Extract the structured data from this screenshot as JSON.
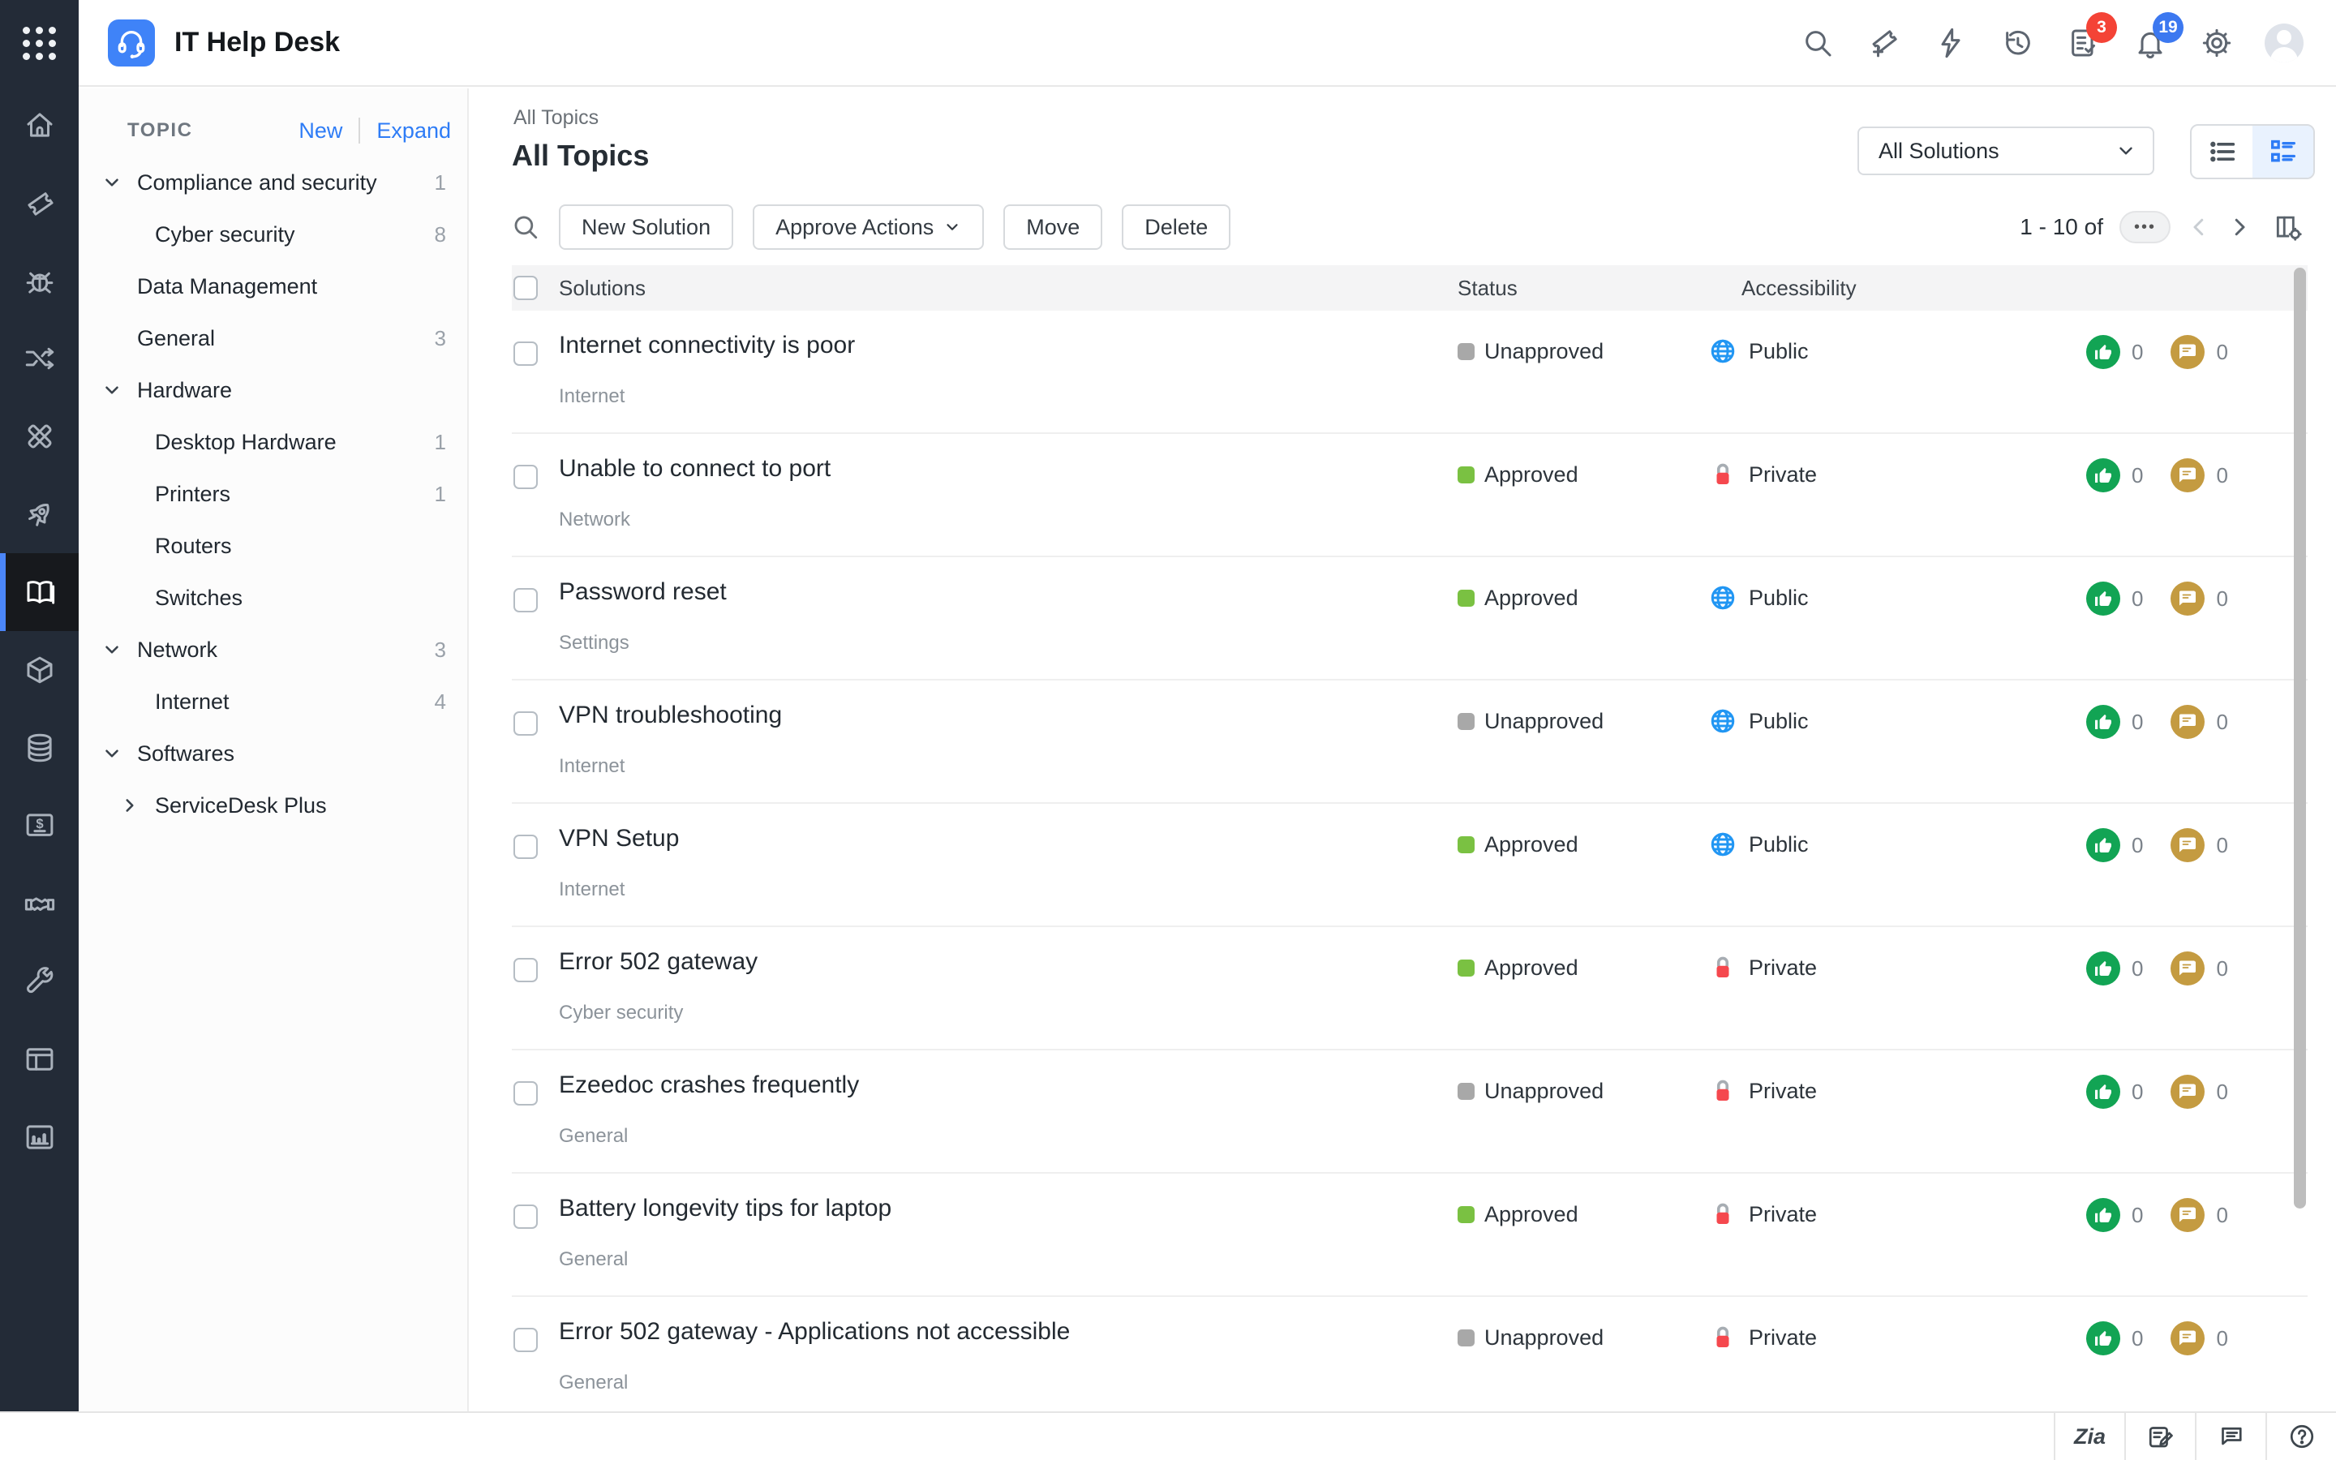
{
  "app": {
    "name": "IT Help Desk"
  },
  "topbar": {
    "icons": [
      "search-icon",
      "new-ticket-icon",
      "quick-actions-icon",
      "history-icon",
      "approvals-icon",
      "notifications-icon",
      "settings-icon",
      "avatar"
    ],
    "approvals_badge": "3",
    "notifications_badge": "19"
  },
  "rail": {
    "items": [
      "home",
      "tickets",
      "bugs",
      "changes",
      "projects",
      "releases",
      "solutions",
      "assets",
      "cmdb",
      "purchases",
      "contracts",
      "admin",
      "custom-views",
      "reports"
    ],
    "active": "solutions"
  },
  "sidebar": {
    "heading": "TOPIC",
    "new_label": "New",
    "expand_label": "Expand",
    "items": [
      {
        "label": "Compliance and security",
        "count": "1",
        "level": 0,
        "chevron": "down"
      },
      {
        "label": "Cyber security",
        "count": "8",
        "level": 1,
        "chevron": "none"
      },
      {
        "label": "Data Management",
        "count": "",
        "level": 0,
        "chevron": "none"
      },
      {
        "label": "General",
        "count": "3",
        "level": 0,
        "chevron": "none"
      },
      {
        "label": "Hardware",
        "count": "",
        "level": 0,
        "chevron": "down"
      },
      {
        "label": "Desktop Hardware",
        "count": "1",
        "level": 1,
        "chevron": "none"
      },
      {
        "label": "Printers",
        "count": "1",
        "level": 1,
        "chevron": "none"
      },
      {
        "label": "Routers",
        "count": "",
        "level": 1,
        "chevron": "none"
      },
      {
        "label": "Switches",
        "count": "",
        "level": 1,
        "chevron": "none"
      },
      {
        "label": "Network",
        "count": "3",
        "level": 0,
        "chevron": "down"
      },
      {
        "label": "Internet",
        "count": "4",
        "level": 1,
        "chevron": "none"
      },
      {
        "label": "Softwares",
        "count": "",
        "level": 0,
        "chevron": "down"
      },
      {
        "label": "ServiceDesk Plus",
        "count": "",
        "level": 1,
        "chevron": "right"
      }
    ]
  },
  "main": {
    "breadcrumb": "All Topics",
    "title": "All Topics",
    "filter_value": "All Solutions",
    "toolbar": {
      "new_solution": "New Solution",
      "approve_actions": "Approve Actions",
      "move": "Move",
      "delete": "Delete"
    },
    "pagination": {
      "range": "1 - 10 of",
      "more": "•••"
    },
    "table": {
      "columns": {
        "solutions": "Solutions",
        "status": "Status",
        "accessibility": "Accessibility"
      },
      "rows": [
        {
          "title": "Internet connectivity is poor",
          "topic": "Internet",
          "status": "Unapproved",
          "accessibility": "Public",
          "likes": "0",
          "comments": "0"
        },
        {
          "title": "Unable to connect to port",
          "topic": "Network",
          "status": "Approved",
          "accessibility": "Private",
          "likes": "0",
          "comments": "0"
        },
        {
          "title": "Password reset",
          "topic": "Settings",
          "status": "Approved",
          "accessibility": "Public",
          "likes": "0",
          "comments": "0"
        },
        {
          "title": "VPN troubleshooting",
          "topic": "Internet",
          "status": "Unapproved",
          "accessibility": "Public",
          "likes": "0",
          "comments": "0"
        },
        {
          "title": "VPN Setup",
          "topic": "Internet",
          "status": "Approved",
          "accessibility": "Public",
          "likes": "0",
          "comments": "0"
        },
        {
          "title": "Error 502 gateway",
          "topic": "Cyber security",
          "status": "Approved",
          "accessibility": "Private",
          "likes": "0",
          "comments": "0"
        },
        {
          "title": "Ezeedoc crashes frequently",
          "topic": "General",
          "status": "Unapproved",
          "accessibility": "Private",
          "likes": "0",
          "comments": "0"
        },
        {
          "title": "Battery longevity tips for laptop",
          "topic": "General",
          "status": "Approved",
          "accessibility": "Private",
          "likes": "0",
          "comments": "0"
        },
        {
          "title": "Error 502 gateway - Applications not accessible",
          "topic": "General",
          "status": "Unapproved",
          "accessibility": "Private",
          "likes": "0",
          "comments": "0"
        }
      ]
    }
  },
  "bottombar": {
    "zia_label": "Zia",
    "icons": [
      "zia-icon",
      "compose-icon",
      "feedback-icon",
      "help-icon"
    ]
  },
  "colors": {
    "accent_blue": "#2e7cf6",
    "logo_blue": "#3f83f8",
    "rail_bg": "#232b37",
    "approved_green": "#7ac142",
    "unapproved_gray": "#a8a8a8",
    "public_blue": "#2196f3",
    "private_red": "#f5484e",
    "like_green": "#12a454",
    "comment_gold": "#c49b41",
    "badge_red": "#f44336",
    "badge_blue": "#3c78f0"
  }
}
